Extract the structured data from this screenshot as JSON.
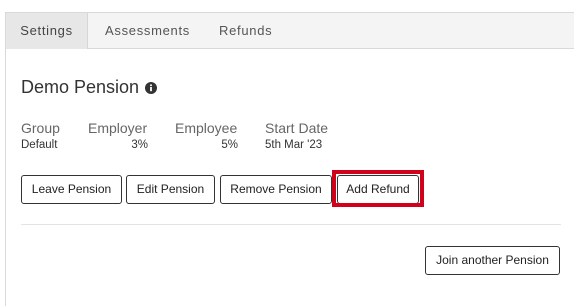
{
  "tabs": [
    {
      "label": "Settings",
      "active": true
    },
    {
      "label": "Assessments",
      "active": false
    },
    {
      "label": "Refunds",
      "active": false
    }
  ],
  "pension": {
    "title": "Demo Pension",
    "info_icon": "info-circle-icon",
    "columns": [
      {
        "label": "Group",
        "value": "Default"
      },
      {
        "label": "Employer",
        "value": "3%"
      },
      {
        "label": "Employee",
        "value": "5%"
      },
      {
        "label": "Start Date",
        "value": "5th Mar '23"
      }
    ]
  },
  "actions": {
    "leave": "Leave Pension",
    "edit": "Edit Pension",
    "remove": "Remove Pension",
    "add_refund": "Add Refund",
    "join_another": "Join another Pension"
  },
  "colors": {
    "highlight": "#d0021b",
    "tab_bar": "#f4f4f4",
    "tab_active": "#e7e7e7"
  }
}
